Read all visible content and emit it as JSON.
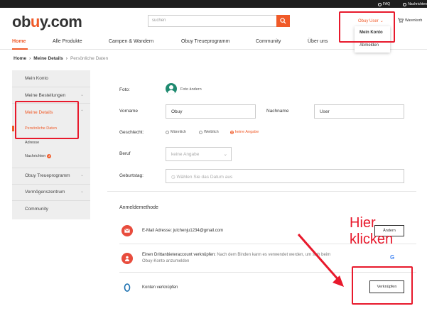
{
  "topbar": {
    "faq": "FAQ",
    "nachrichten": "Nachrichten"
  },
  "header": {
    "logo": "obuy.com",
    "search_placeholder": "suchen",
    "user_label": "Obuy User",
    "cart_label": "Warenkorb"
  },
  "dropdown": {
    "items": [
      "Mein Konto",
      "Abmelden"
    ]
  },
  "nav": {
    "items": [
      "Home",
      "Alle Produkte",
      "Campen & Wandern",
      "Obuy Treueprogramm",
      "Community",
      "Über uns"
    ]
  },
  "breadcrumb": [
    "Home",
    "Meine Details",
    "Persönliche Daten"
  ],
  "sidebar": {
    "mein_konto": "Mein Konto",
    "bestellungen": "Meine Bestellungen",
    "details": "Meine Details",
    "sub_pers": "Persönliche Daten",
    "sub_adresse": "Adresse",
    "sub_nachrichten": "Nachrichten",
    "nachrichten_badge": "2",
    "treue": "Obuy Treueprogramm",
    "vermoegen": "Vermögenszentrum",
    "community": "Community"
  },
  "form": {
    "foto_label": "Foto:",
    "foto_action": "Foto ändern",
    "vorname_label": "Vorname",
    "vorname_value": "Obuy",
    "nachname_label": "Nachname",
    "nachname_value": "User",
    "geschlecht_label": "Geschlecht:",
    "options": [
      "Männlich",
      "Weiblich",
      "keine Angabe"
    ],
    "beruf_label": "Beruf",
    "beruf_value": "keine Angabe",
    "geburtstag_label": "Geburtstag:",
    "geburtstag_placeholder": "Wählen Sie das Datum aus"
  },
  "login": {
    "title": "Anmeldemethode",
    "email_text": "E-Mail Adresse: julchenju1234@gmail.com",
    "email_button": "Ändern",
    "third_party_text": "Einen Drittanbieteraccount verknüpfen:",
    "third_party_hint_1": "Nach dem Binden kann es verwendet werden, um sich beim",
    "third_party_hint_2": "Obuy-Konto anzumelden",
    "google_icon": "G",
    "konten_text": "Konten verknüpfen",
    "konten_button": "Verknüpfen"
  },
  "annotation": {
    "line1": "Hier",
    "line2": "klicken"
  },
  "colors": {
    "accent": "#f05a28",
    "highlight": "#e8192c"
  }
}
